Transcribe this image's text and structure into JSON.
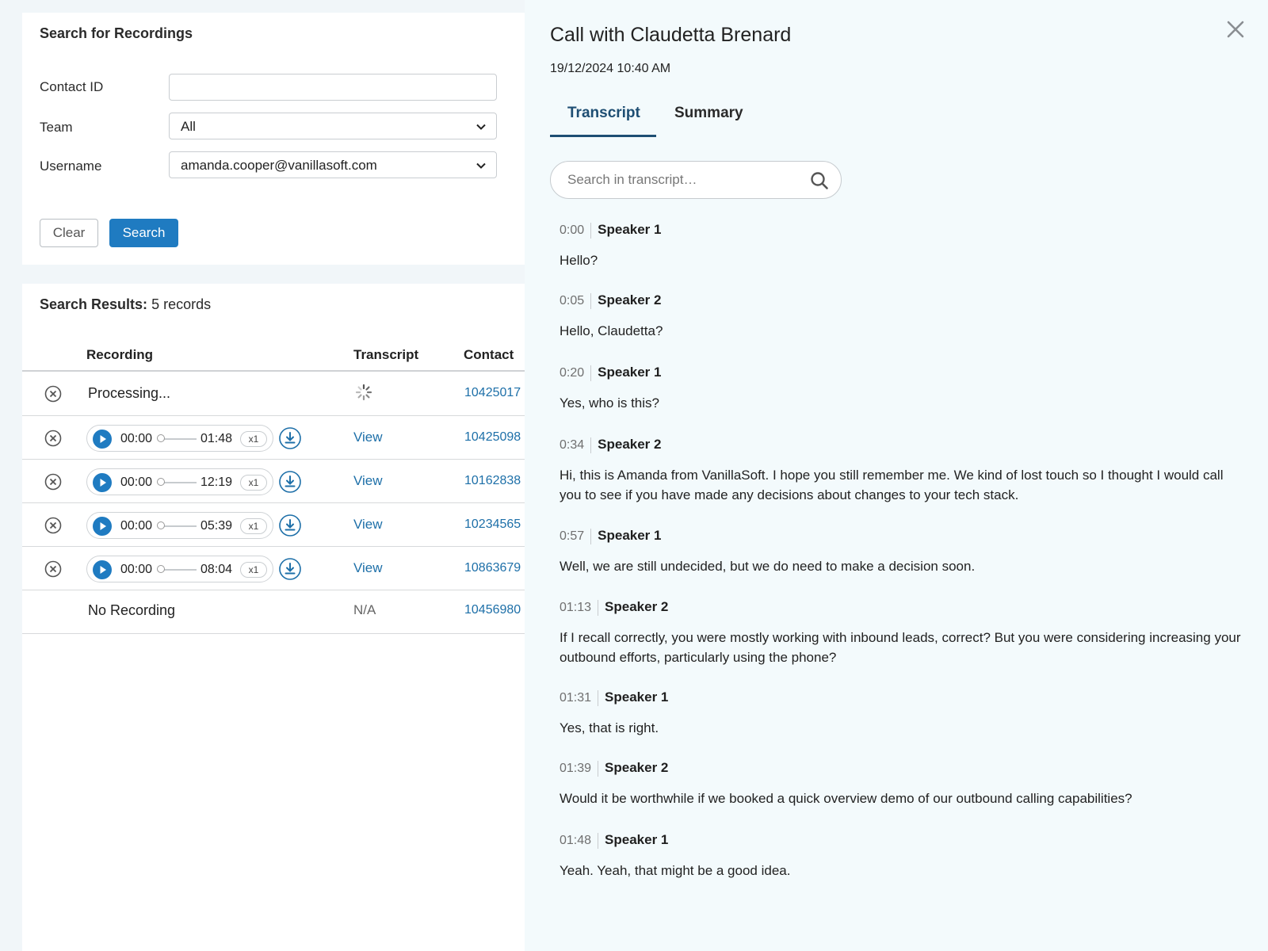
{
  "search_form": {
    "title": "Search for Recordings",
    "contact_id_label": "Contact ID",
    "contact_id_value": "",
    "team_label": "Team",
    "team_value": "All",
    "username_label": "Username",
    "username_value": "amanda.cooper@vanillasoft.com",
    "clear_label": "Clear",
    "search_label": "Search"
  },
  "results": {
    "title_bold": "Search Results:",
    "title_count": "5 records",
    "headers": {
      "recording": "Recording",
      "transcript": "Transcript",
      "contact": "Contact"
    },
    "processing_row": {
      "recording": "Processing...",
      "contact": "10425017"
    },
    "player_rows": [
      {
        "start": "00:00",
        "end": "01:48",
        "speed": "x1",
        "transcript": "View",
        "contact": "10425098"
      },
      {
        "start": "00:00",
        "end": "12:19",
        "speed": "x1",
        "transcript": "View",
        "contact": "10162838"
      },
      {
        "start": "00:00",
        "end": "05:39",
        "speed": "x1",
        "transcript": "View",
        "contact": "10234565"
      },
      {
        "start": "00:00",
        "end": "08:04",
        "speed": "x1",
        "transcript": "View",
        "contact": "10863679"
      }
    ],
    "norec_row": {
      "recording": "No Recording",
      "transcript": "N/A",
      "contact": "10456980"
    }
  },
  "drawer": {
    "title": "Call with Claudetta Brenard",
    "datetime": "19/12/2024 10:40 AM",
    "tabs": [
      "Transcript",
      "Summary"
    ],
    "search_placeholder": "Search in transcript…",
    "segments": [
      {
        "time": "0:00",
        "speaker": "Speaker 1",
        "text": "Hello?"
      },
      {
        "time": "0:05",
        "speaker": "Speaker 2",
        "text": "Hello, Claudetta?"
      },
      {
        "time": "0:20",
        "speaker": "Speaker 1",
        "text": "Yes, who is this?"
      },
      {
        "time": "0:34",
        "speaker": "Speaker 2",
        "text": "Hi, this is Amanda from VanillaSoft. I hope you still remember me. We kind of lost touch so I thought I would call you to see if you have made any decisions about changes to your tech stack."
      },
      {
        "time": "0:57",
        "speaker": "Speaker 1",
        "text": "Well, we are still undecided, but we do need to make a decision soon."
      },
      {
        "time": "01:13",
        "speaker": "Speaker 2",
        "text": "If I recall correctly, you were mostly working with inbound leads, correct? But you were considering increasing your outbound efforts, particularly using the phone?"
      },
      {
        "time": "01:31",
        "speaker": "Speaker 1",
        "text": "Yes, that is right."
      },
      {
        "time": "01:39",
        "speaker": "Speaker 2",
        "text": "Would it be worthwhile if we booked a quick overview demo of our outbound calling capabilities?"
      },
      {
        "time": "01:48",
        "speaker": "Speaker 1",
        "text": "Yeah. Yeah, that might be a good idea."
      }
    ]
  },
  "colors": {
    "accent": "#1f7bc1",
    "link": "#1d6fa8",
    "tab_active": "#1e4e73",
    "drawer_bg": "#f3fafc"
  },
  "icons": [
    "x-circle-icon",
    "spinner-icon",
    "play-icon",
    "download-icon",
    "chevron-down-icon",
    "close-icon",
    "search-icon"
  ]
}
